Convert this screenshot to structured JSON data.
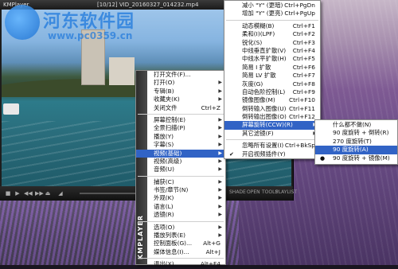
{
  "window": {
    "logo": "KMPlayer",
    "file_title": "[10/12] VID_20160327_014232.mp4"
  },
  "watermark": {
    "text": "河东软件园",
    "url": "www.pc0359.cn"
  },
  "controls": {
    "right_labels": [
      "SHADE",
      "OPEN",
      "TOOLS",
      "PLAYLIST"
    ]
  },
  "main_menu": {
    "brand": "KMPLAYER",
    "brand_sub": "Main Control",
    "items": [
      {
        "label": "打开文件(F)...",
        "shortcut": "",
        "submenu": false
      },
      {
        "label": "打开(O)",
        "shortcut": "",
        "submenu": true
      },
      {
        "label": "专辑(B)",
        "shortcut": "",
        "submenu": true
      },
      {
        "label": "收藏夹(K)",
        "shortcut": "",
        "submenu": true
      },
      {
        "label": "关闭文件",
        "shortcut": "Ctrl+Z",
        "submenu": false
      },
      {
        "sep": true
      },
      {
        "label": "屏幕控制(E)",
        "shortcut": "",
        "submenu": true
      },
      {
        "label": "全景扫描(P)",
        "shortcut": "",
        "submenu": true
      },
      {
        "label": "播放(Y)",
        "shortcut": "",
        "submenu": true
      },
      {
        "label": "字幕(S)",
        "shortcut": "",
        "submenu": true
      },
      {
        "label": "视频(基础)",
        "shortcut": "",
        "submenu": true,
        "highlight": true
      },
      {
        "label": "视频(高级)",
        "shortcut": "",
        "submenu": true
      },
      {
        "label": "音频(U)",
        "shortcut": "",
        "submenu": true
      },
      {
        "sep": true
      },
      {
        "label": "捕获(C)",
        "shortcut": "",
        "submenu": true
      },
      {
        "label": "书签/章节(N)",
        "shortcut": "",
        "submenu": true
      },
      {
        "label": "外观(K)",
        "shortcut": "",
        "submenu": true
      },
      {
        "label": "语言(L)",
        "shortcut": "",
        "submenu": true
      },
      {
        "label": "透镜(R)",
        "shortcut": "",
        "submenu": true
      },
      {
        "sep": true
      },
      {
        "label": "选项(O)",
        "shortcut": "",
        "submenu": true
      },
      {
        "label": "播放列表(E)",
        "shortcut": "",
        "submenu": true
      },
      {
        "label": "控制面板(G)...",
        "shortcut": "Alt+G",
        "submenu": false
      },
      {
        "label": "媒体信息(I)...",
        "shortcut": "Alt+J",
        "submenu": false
      },
      {
        "sep": true
      },
      {
        "label": "退出(X)",
        "shortcut": "Alt+F4",
        "submenu": false
      }
    ]
  },
  "video_menu": {
    "items": [
      {
        "label": "减小 \"Y\" (更暗)",
        "shortcut": "Ctrl+PgDn"
      },
      {
        "label": "增加 \"Y\" (更亮)",
        "shortcut": "Ctrl+PgUp"
      },
      {
        "sep": true
      },
      {
        "label": "动态模糊(B)",
        "shortcut": "Ctrl+F1"
      },
      {
        "label": "柔和(I)(LPF)",
        "shortcut": "Ctrl+F2"
      },
      {
        "label": "锐化(S)",
        "shortcut": "Ctrl+F3"
      },
      {
        "label": "中线垂直扩散(V)",
        "shortcut": "Ctrl+F4"
      },
      {
        "label": "中线水平扩散(H)",
        "shortcut": "Ctrl+F5"
      },
      {
        "label": "简易 I 扩散",
        "shortcut": "Ctrl+F6"
      },
      {
        "label": "简易 LV 扩散",
        "shortcut": "Ctrl+F7"
      },
      {
        "label": "灰度(G)",
        "shortcut": "Ctrl+F8"
      },
      {
        "label": "自动色阶控制(L)",
        "shortcut": "Ctrl+F9"
      },
      {
        "label": "镜像图像(M)",
        "shortcut": "Ctrl+F10"
      },
      {
        "label": "倒转输入图像(U)",
        "shortcut": "Ctrl+F11"
      },
      {
        "label": "倒转输出图像(O)",
        "shortcut": "Ctrl+F12"
      },
      {
        "label": "屏幕旋转(CCW)(R)",
        "shortcut": "",
        "submenu": true,
        "highlight": true
      },
      {
        "label": "其它滤镜(F)",
        "shortcut": "",
        "submenu": true
      },
      {
        "sep": true
      },
      {
        "label": "忽略所有设置(I)",
        "shortcut": "Ctrl+BkSp"
      },
      {
        "label": "开启视频插件(Y)",
        "shortcut": "",
        "checked": true
      }
    ]
  },
  "rotate_menu": {
    "items": [
      {
        "label": "什么都不做(N)"
      },
      {
        "label": "90 度旋转 + 倒转(R)"
      },
      {
        "label": "270 度旋转(T)"
      },
      {
        "label": "90 度旋转(A)",
        "highlight": true
      },
      {
        "label": "90 度旋转 + 镜像(M)",
        "dot": true
      }
    ]
  }
}
